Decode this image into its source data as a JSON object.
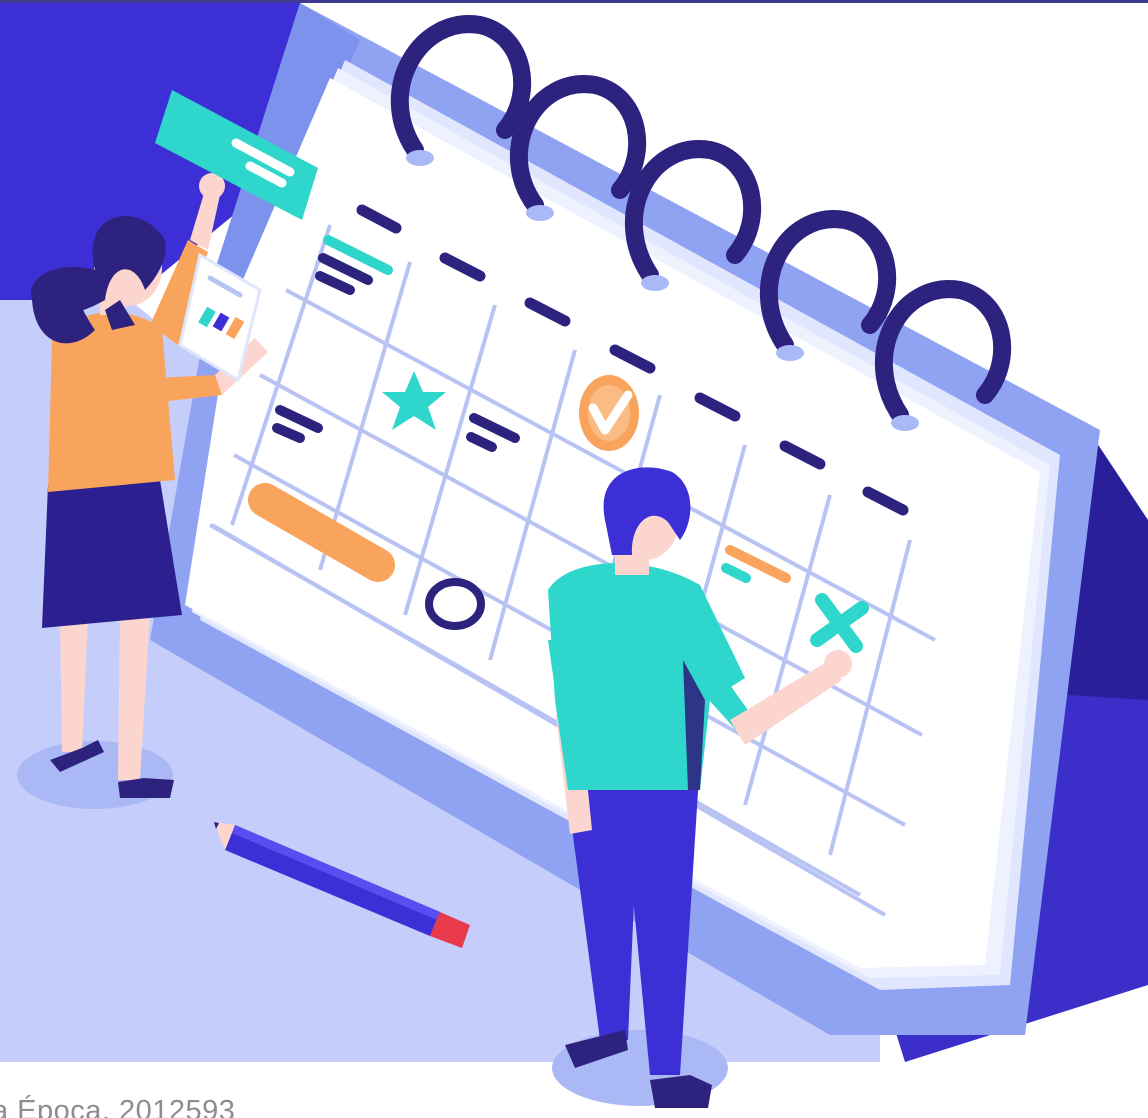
{
  "illustration": {
    "subject": "calendar-planning",
    "colors": {
      "indigo": "#3d2fd6",
      "indigo_dark": "#2a1f9a",
      "navy": "#2d237f",
      "lavender": "#c2cdfb",
      "periwinkle": "#8fa3f2",
      "sky": "#a9b9f7",
      "teal": "#2ed6cc",
      "orange": "#f9a45c",
      "skin": "#fcd5cf",
      "paper": "#ffffff",
      "grid": "#b8c3f4",
      "pencil_red": "#e83a4a"
    }
  },
  "caption": {
    "text": "a Época, 2012593"
  }
}
